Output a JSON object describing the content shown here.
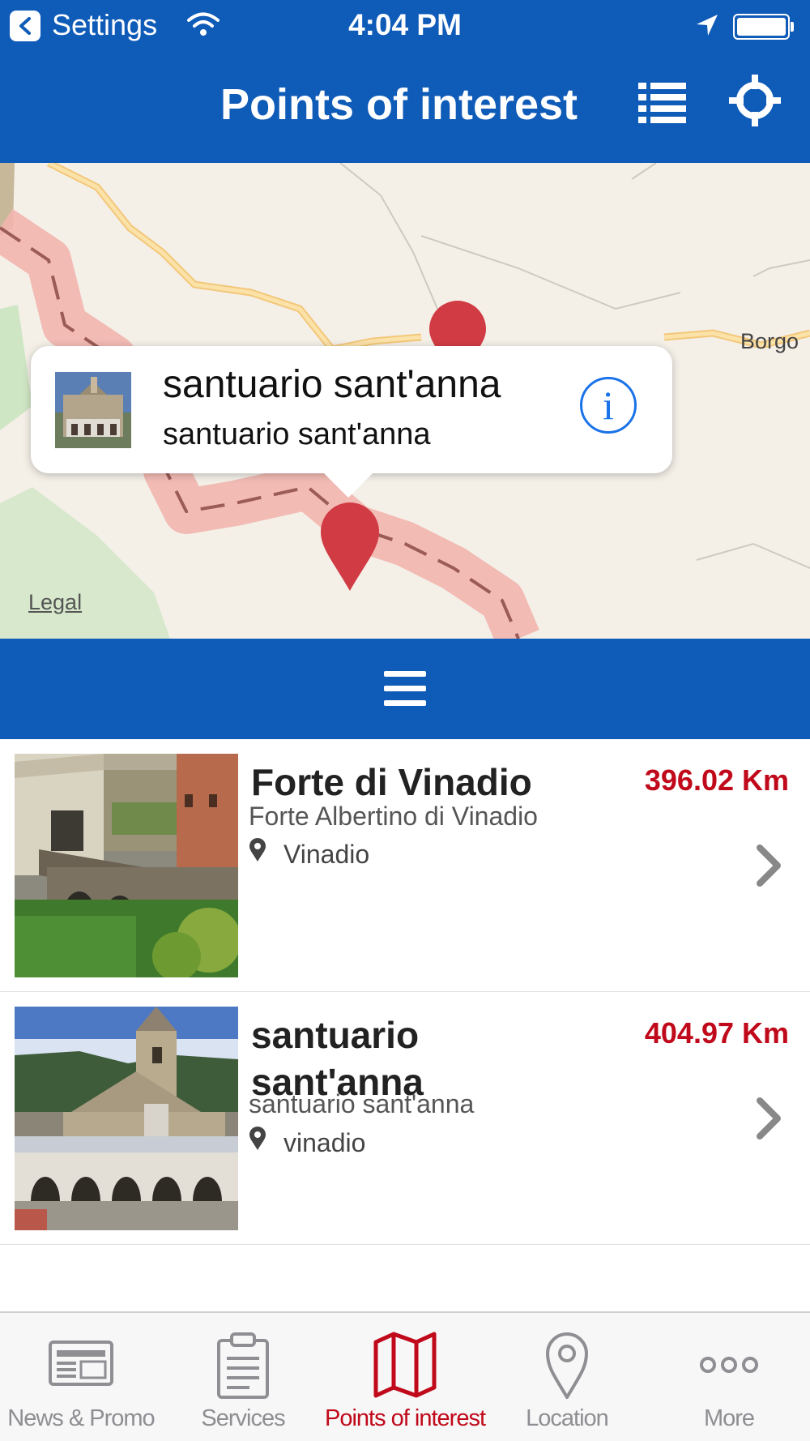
{
  "status_bar": {
    "back_app": "Settings",
    "time": "4:04 PM",
    "icons": [
      "back-arrow-icon",
      "wifi-icon",
      "location-arrow-icon",
      "battery-icon"
    ]
  },
  "nav_bar": {
    "title": "Points of interest",
    "icons": [
      "list-icon",
      "crosshair-icon"
    ]
  },
  "map": {
    "place_label": "Borgo",
    "legal": "Legal",
    "callout": {
      "title": "santuario sant'anna",
      "subtitle": "santuario sant'anna",
      "icon": "info-icon"
    }
  },
  "drawer": {
    "icon": "hamburger-menu-icon"
  },
  "poi_list": [
    {
      "title": "Forte di Vinadio",
      "subtitle": "Forte Albertino di Vinadio",
      "location": "Vinadio",
      "distance": "396.02 Km"
    },
    {
      "title": "santuario sant'anna",
      "subtitle": "santuario sant'anna",
      "location": "vinadio",
      "distance": "404.97 Km"
    }
  ],
  "tab_bar": {
    "items": [
      {
        "label": "News & Promo",
        "icon": "newspaper-icon",
        "active": false
      },
      {
        "label": "Services",
        "icon": "clipboard-icon",
        "active": false
      },
      {
        "label": "Points of interest",
        "icon": "map-icon",
        "active": true
      },
      {
        "label": "Location",
        "icon": "location-pin-icon",
        "active": false
      },
      {
        "label": "More",
        "icon": "more-dots-icon",
        "active": false
      }
    ]
  },
  "colors": {
    "brand_blue": "#0f5bb8",
    "accent_red": "#c0091a",
    "info_blue": "#1a73e8",
    "tab_inactive": "#8e8e93"
  }
}
